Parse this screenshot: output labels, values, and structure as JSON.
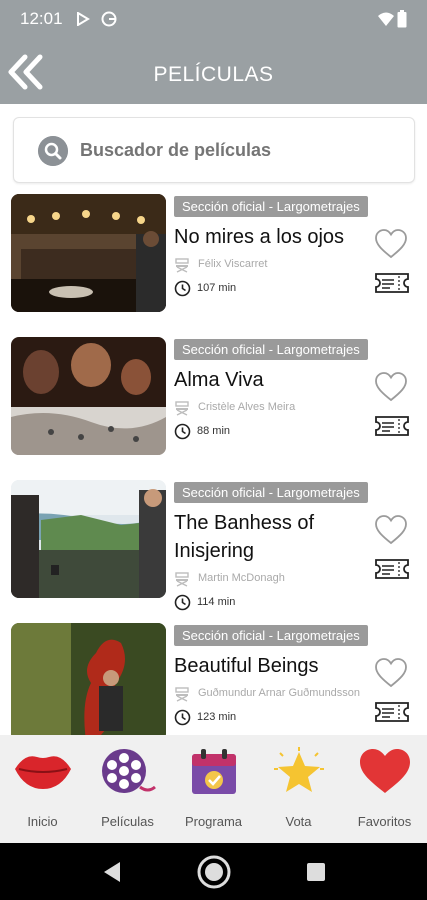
{
  "status_bar": {
    "time": "12:01"
  },
  "header": {
    "title": "PELÍCULAS",
    "back_icon": "double-chevron-left-icon"
  },
  "search": {
    "placeholder": "Buscador de películas",
    "icon": "search-icon"
  },
  "films": [
    {
      "section": "Sección oficial - Largometrajes",
      "title": "No mires a los ojos",
      "director": "Félix Viscarret",
      "duration": "107 min",
      "favorite": false
    },
    {
      "section": "Sección oficial - Largometrajes",
      "title": "Alma Viva",
      "director": "Cristèle Alves Meira",
      "duration": "88 min",
      "favorite": false
    },
    {
      "section": "Sección oficial - Largometrajes",
      "title": "The Banhess of Inisjering",
      "director": "Martin McDonagh",
      "duration": "114 min",
      "favorite": false
    },
    {
      "section": "Sección oficial - Largometrajes",
      "title": "Beautiful Beings",
      "director": "Guðmundur Arnar Guðmundsson",
      "duration": "123 min",
      "favorite": false
    }
  ],
  "bottom_nav": [
    {
      "label": "Inicio",
      "icon": "lips-icon"
    },
    {
      "label": "Películas",
      "icon": "film-reel-icon"
    },
    {
      "label": "Programa",
      "icon": "calendar-icon"
    },
    {
      "label": "Vota",
      "icon": "star-icon"
    },
    {
      "label": "Favoritos",
      "icon": "heart-icon"
    }
  ],
  "colors": {
    "app_bar": "#9aa0a3",
    "tag_bg": "#9a9a9a",
    "nav_bg": "#f0f0f0"
  }
}
